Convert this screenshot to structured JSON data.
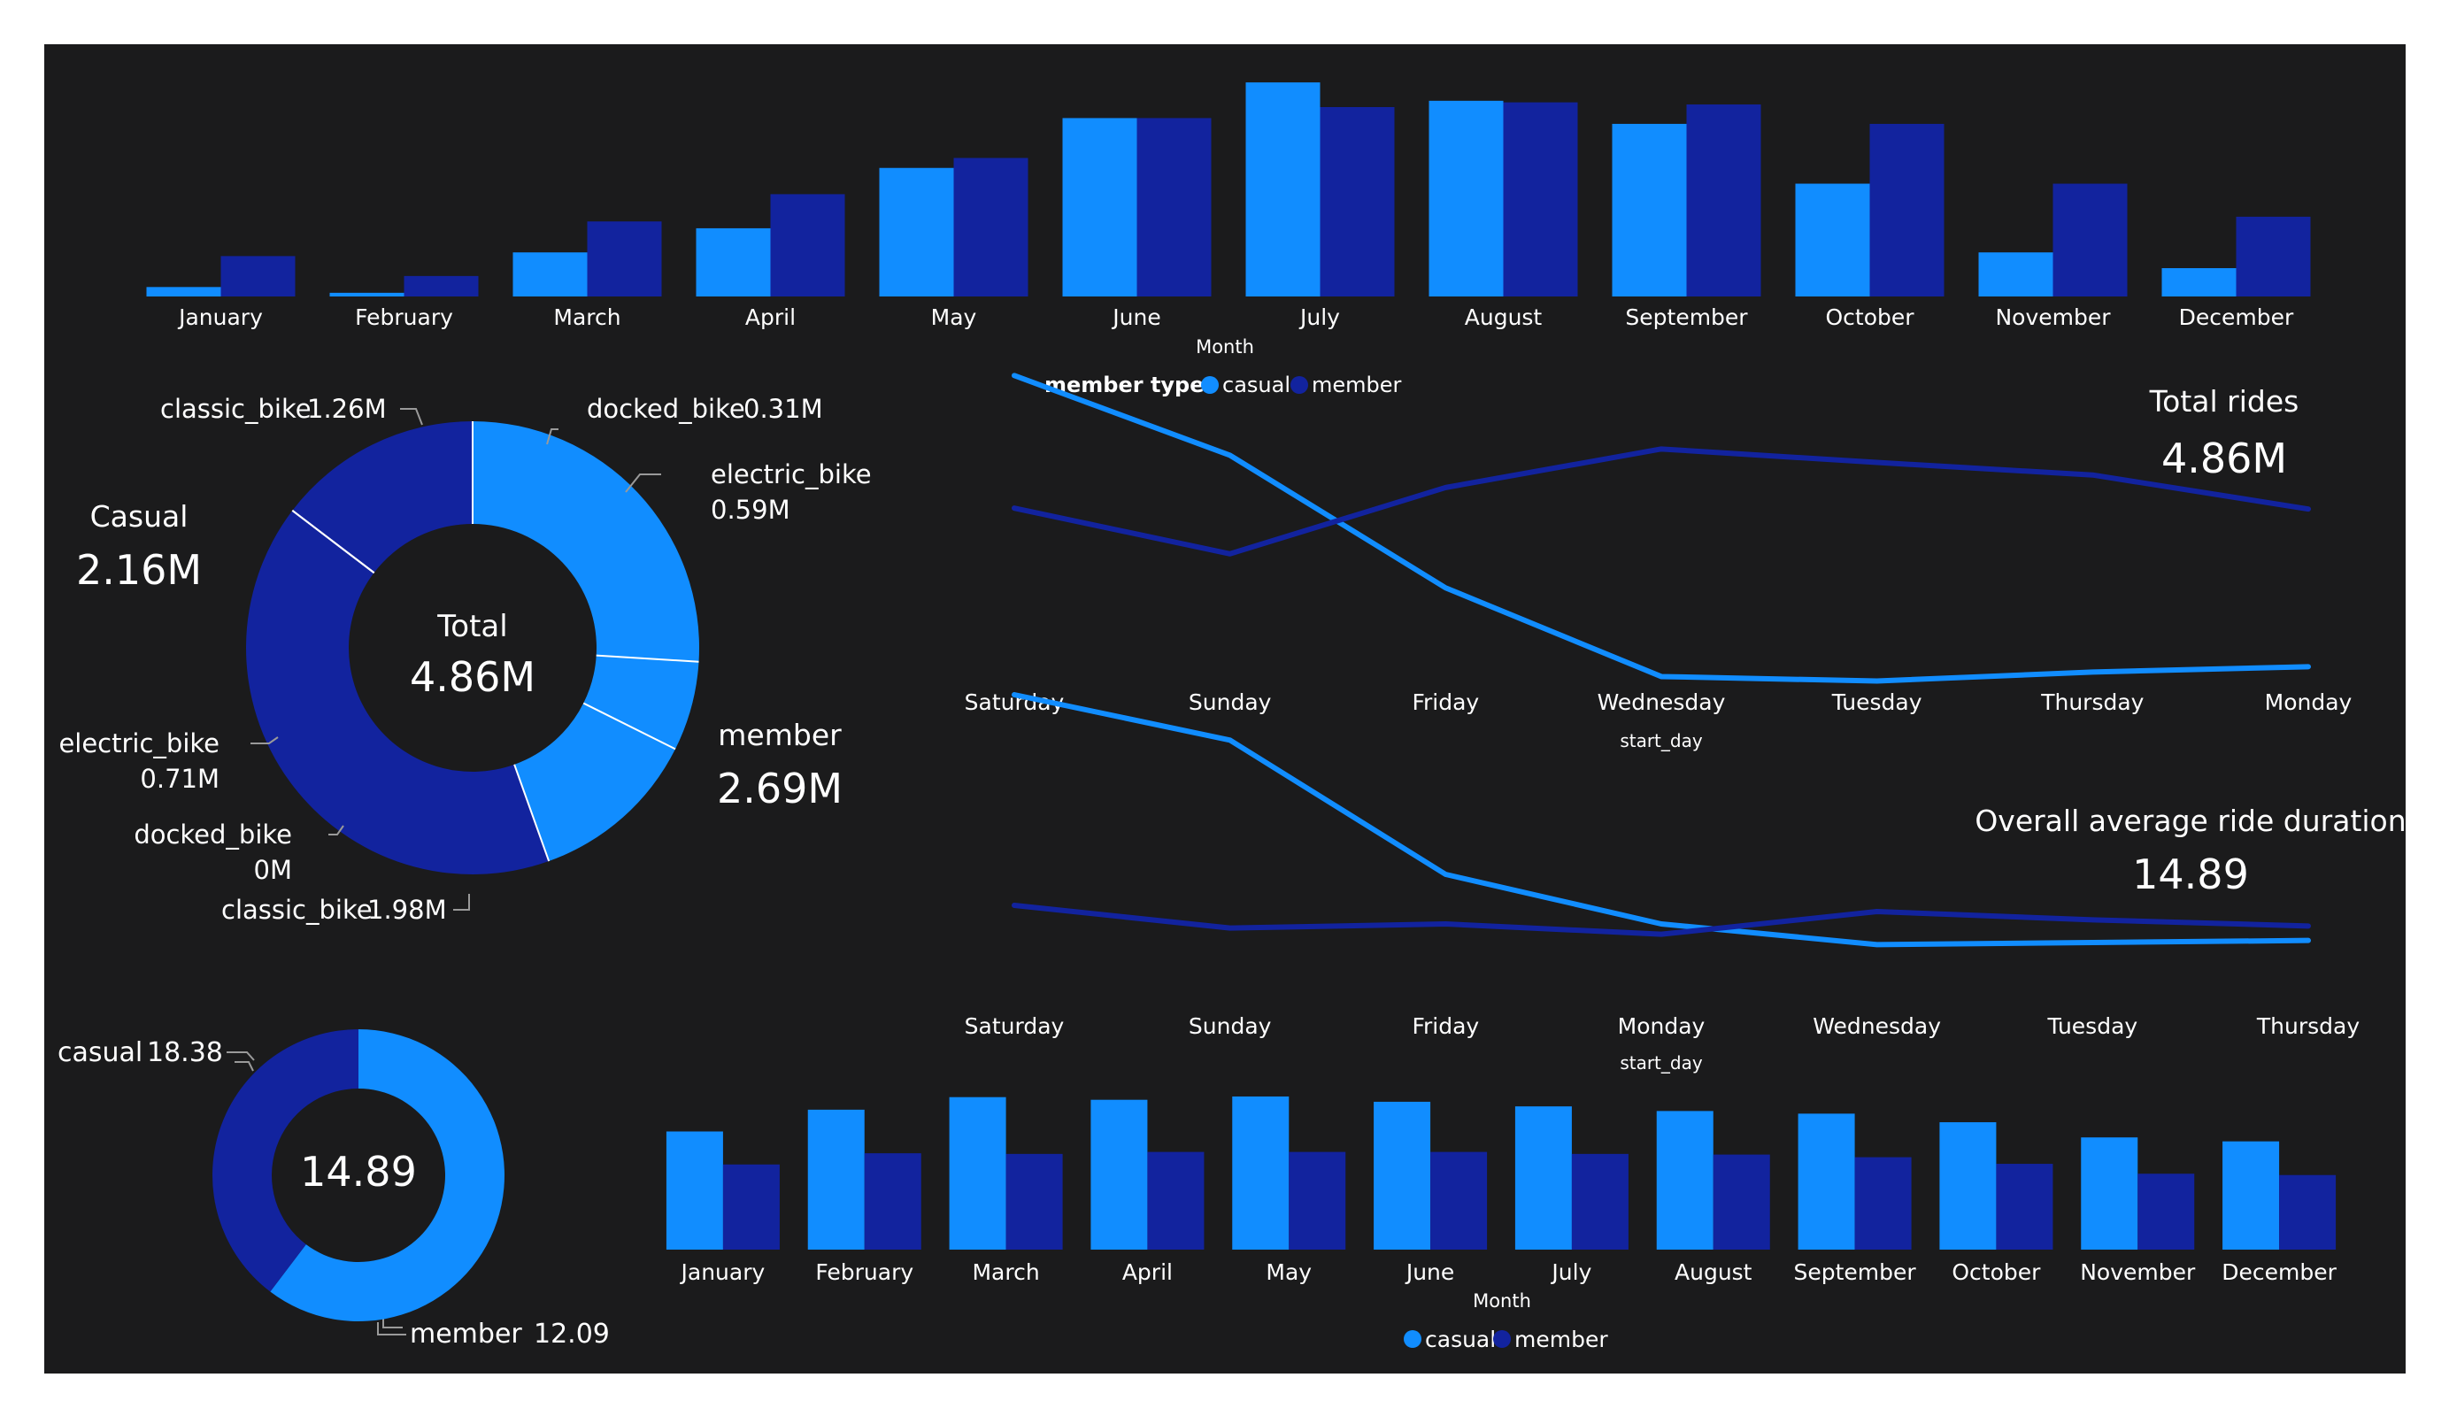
{
  "colors": {
    "background": "#1b1b1c",
    "casual": "#118dff",
    "member": "#12239e",
    "text": "#ffffff",
    "leader": "#9a9a9a"
  },
  "legend_title": "member type",
  "legend_casual": "casual",
  "legend_member": "member",
  "kpis": {
    "total_rides_label": "Total rides",
    "total_rides_value": "4.86M",
    "avg_duration_label": "Overall average ride duration",
    "avg_duration_value": "14.89"
  },
  "chart_data": [
    {
      "id": "rides_by_month",
      "type": "bar",
      "xlabel": "Month",
      "categories": [
        "January",
        "February",
        "March",
        "April",
        "May",
        "June",
        "July",
        "August",
        "September",
        "October",
        "November",
        "December"
      ],
      "series": [
        {
          "name": "casual",
          "values": [
            18,
            7,
            84,
            130,
            245,
            340,
            408,
            373,
            329,
            215,
            84,
            54
          ]
        },
        {
          "name": "member",
          "values": [
            77,
            39,
            143,
            195,
            264,
            340,
            361,
            370,
            366,
            329,
            215,
            152
          ]
        }
      ],
      "ylim": [
        0,
        420
      ],
      "legend": {
        "title": "member type",
        "position": "bottom-left"
      }
    },
    {
      "id": "rides_by_type_donut",
      "type": "pie",
      "center_label": "Total",
      "center_value": "4.86M",
      "groups": [
        {
          "name": "Casual",
          "value_label": "2.16M"
        },
        {
          "name": "member",
          "value_label": "2.69M"
        }
      ],
      "slices": [
        {
          "member": "casual",
          "label": "classic_bike",
          "value_label": "1.26M",
          "value": 1.26
        },
        {
          "member": "casual",
          "label": "docked_bike",
          "value_label": "0.31M",
          "value": 0.31
        },
        {
          "member": "casual",
          "label": "electric_bike",
          "value_label": "0.59M",
          "value": 0.59
        },
        {
          "member": "member",
          "label": "classic_bike",
          "value_label": "1.98M",
          "value": 1.98
        },
        {
          "member": "member",
          "label": "docked_bike",
          "value_label": "0M",
          "value": 0.0
        },
        {
          "member": "member",
          "label": "electric_bike",
          "value_label": "0.71M",
          "value": 0.71
        }
      ]
    },
    {
      "id": "rides_by_day",
      "type": "line",
      "xlabel": "start_day",
      "categories": [
        "Saturday",
        "Sunday",
        "Friday",
        "Wednesday",
        "Tuesday",
        "Thursday",
        "Monday"
      ],
      "series": [
        {
          "name": "casual",
          "values": [
            481,
            392,
            244,
            145,
            140,
            150,
            156
          ]
        },
        {
          "name": "member",
          "values": [
            333,
            282,
            356,
            399,
            384,
            370,
            332
          ]
        }
      ],
      "ylim": [
        100,
        510
      ]
    },
    {
      "id": "duration_by_day",
      "type": "line",
      "xlabel": "start_day",
      "categories": [
        "Saturday",
        "Sunday",
        "Friday",
        "Monday",
        "Wednesday",
        "Tuesday",
        "Thursday"
      ],
      "series": [
        {
          "name": "casual",
          "values": [
            24.5,
            22.3,
            15.8,
            13.4,
            12.4,
            12.5,
            12.6
          ]
        },
        {
          "name": "member",
          "values": [
            14.3,
            13.2,
            13.4,
            12.9,
            14.0,
            13.6,
            13.3
          ]
        }
      ],
      "ylim": [
        8,
        26
      ]
    },
    {
      "id": "avg_duration_donut",
      "type": "pie",
      "center_value": "14.89",
      "slices": [
        {
          "label": "casual",
          "value_label": "18.38",
          "value": 18.38
        },
        {
          "label": "member",
          "value_label": "12.09",
          "value": 12.09
        }
      ]
    },
    {
      "id": "duration_by_month",
      "type": "bar",
      "xlabel": "Month",
      "categories": [
        "January",
        "February",
        "March",
        "April",
        "May",
        "June",
        "July",
        "August",
        "September",
        "October",
        "November",
        "December"
      ],
      "series": [
        {
          "name": "casual",
          "values": [
            17.9,
            21.2,
            23.1,
            22.7,
            23.2,
            22.4,
            21.7,
            21.0,
            20.6,
            19.3,
            17.0,
            16.4
          ]
        },
        {
          "name": "member",
          "values": [
            12.9,
            14.6,
            14.5,
            14.8,
            14.8,
            14.8,
            14.5,
            14.4,
            14.0,
            13.0,
            11.5,
            11.3
          ]
        }
      ],
      "ylim": [
        0,
        24
      ],
      "legend": {
        "position": "bottom-center"
      }
    }
  ]
}
